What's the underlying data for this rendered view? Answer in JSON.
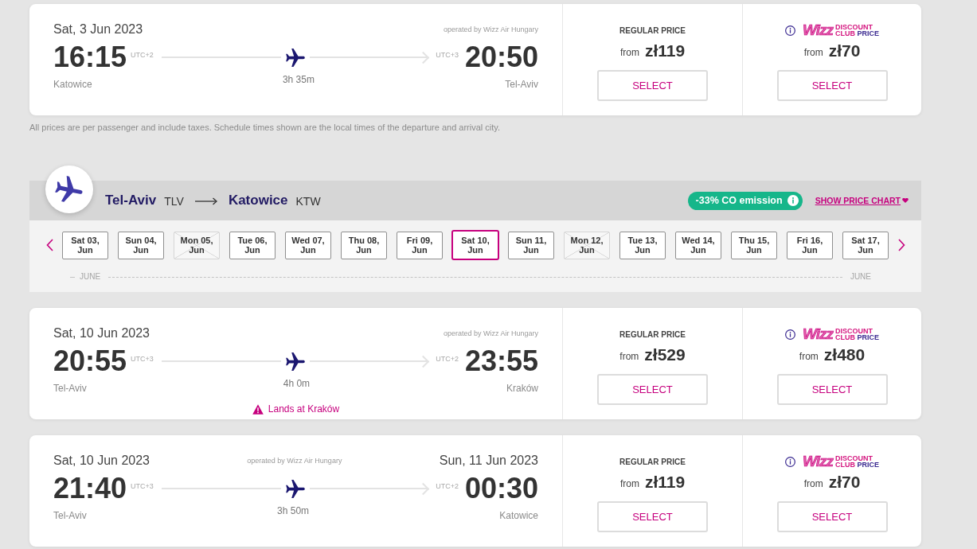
{
  "outbound_flights": [
    {
      "departure_date": "Sat, 3 Jun 2023",
      "operated_by": "operated by Wizz Air Hungary",
      "departure_time": "16:15",
      "departure_utc": "UTC+2",
      "departure_city": "Katowice",
      "duration": "3h 35m",
      "arrival_utc": "UTC+3",
      "arrival_time": "20:50",
      "arrival_city": "Tel-Aviv",
      "fares": [
        {
          "kind": "regular",
          "title": "REGULAR PRICE",
          "from": "from",
          "price": "zł119",
          "button": "SELECT"
        },
        {
          "kind": "club",
          "logo": "Wizz",
          "words": [
            "DISCOUNT",
            "CLUB",
            "PRICE"
          ],
          "from": "from",
          "price": "zł70",
          "button": "SELECT"
        }
      ]
    }
  ],
  "disclaimer": "All prices are per passenger and include taxes. Schedule times shown are the local times of the departure and arrival city.",
  "return_journey": {
    "route": {
      "origin_city": "Tel-Aviv",
      "origin_code": "TLV",
      "destination_city": "Katowice",
      "destination_code": "KTW"
    },
    "emission_badge": "-33% CO emission",
    "price_chart_link": "SHOW PRICE CHART",
    "dates": [
      {
        "day": "Sat 03,",
        "month": "Jun",
        "selected": false,
        "disabled": false
      },
      {
        "day": "Sun 04,",
        "month": "Jun",
        "selected": false,
        "disabled": false
      },
      {
        "day": "Mon 05,",
        "month": "Jun",
        "selected": false,
        "disabled": true
      },
      {
        "day": "Tue 06,",
        "month": "Jun",
        "selected": false,
        "disabled": false
      },
      {
        "day": "Wed 07,",
        "month": "Jun",
        "selected": false,
        "disabled": false
      },
      {
        "day": "Thu 08,",
        "month": "Jun",
        "selected": false,
        "disabled": false
      },
      {
        "day": "Fri 09,",
        "month": "Jun",
        "selected": false,
        "disabled": false
      },
      {
        "day": "Sat 10,",
        "month": "Jun",
        "selected": true,
        "disabled": false
      },
      {
        "day": "Sun 11,",
        "month": "Jun",
        "selected": false,
        "disabled": false
      },
      {
        "day": "Mon 12,",
        "month": "Jun",
        "selected": false,
        "disabled": true
      },
      {
        "day": "Tue 13,",
        "month": "Jun",
        "selected": false,
        "disabled": false
      },
      {
        "day": "Wed 14,",
        "month": "Jun",
        "selected": false,
        "disabled": false
      },
      {
        "day": "Thu 15,",
        "month": "Jun",
        "selected": false,
        "disabled": false
      },
      {
        "day": "Fri 16,",
        "month": "Jun",
        "selected": false,
        "disabled": false
      },
      {
        "day": "Sat 17,",
        "month": "Jun",
        "selected": false,
        "disabled": false
      }
    ],
    "month_labels": [
      "JUNE",
      "JUNE"
    ],
    "flights": [
      {
        "departure_date": "Sat, 10 Jun 2023",
        "operated_by": "operated by Wizz Air Hungary",
        "departure_time": "20:55",
        "departure_utc": "UTC+3",
        "departure_city": "Tel-Aviv",
        "duration": "4h 0m",
        "arrival_utc": "UTC+2",
        "arrival_time": "23:55",
        "arrival_city": "Kraków",
        "notice": "Lands at Kraków",
        "fares": [
          {
            "kind": "regular",
            "title": "REGULAR PRICE",
            "from": "from",
            "price": "zł529",
            "button": "SELECT"
          },
          {
            "kind": "club",
            "logo": "Wizz",
            "words": [
              "DISCOUNT",
              "CLUB",
              "PRICE"
            ],
            "from": "from",
            "price": "zł480",
            "button": "SELECT"
          }
        ]
      },
      {
        "departure_date": "Sat, 10 Jun 2023",
        "operated_by": "operated by Wizz Air Hungary",
        "arrival_date": "Sun, 11 Jun 2023",
        "departure_time": "21:40",
        "departure_utc": "UTC+3",
        "departure_city": "Tel-Aviv",
        "duration": "3h 50m",
        "arrival_utc": "UTC+2",
        "arrival_time": "00:30",
        "arrival_city": "Katowice",
        "fares": [
          {
            "kind": "regular",
            "title": "REGULAR PRICE",
            "from": "from",
            "price": "zł119",
            "button": "SELECT"
          },
          {
            "kind": "club",
            "logo": "Wizz",
            "words": [
              "DISCOUNT",
              "CLUB",
              "PRICE"
            ],
            "from": "from",
            "price": "zł70",
            "button": "SELECT"
          }
        ]
      }
    ]
  }
}
